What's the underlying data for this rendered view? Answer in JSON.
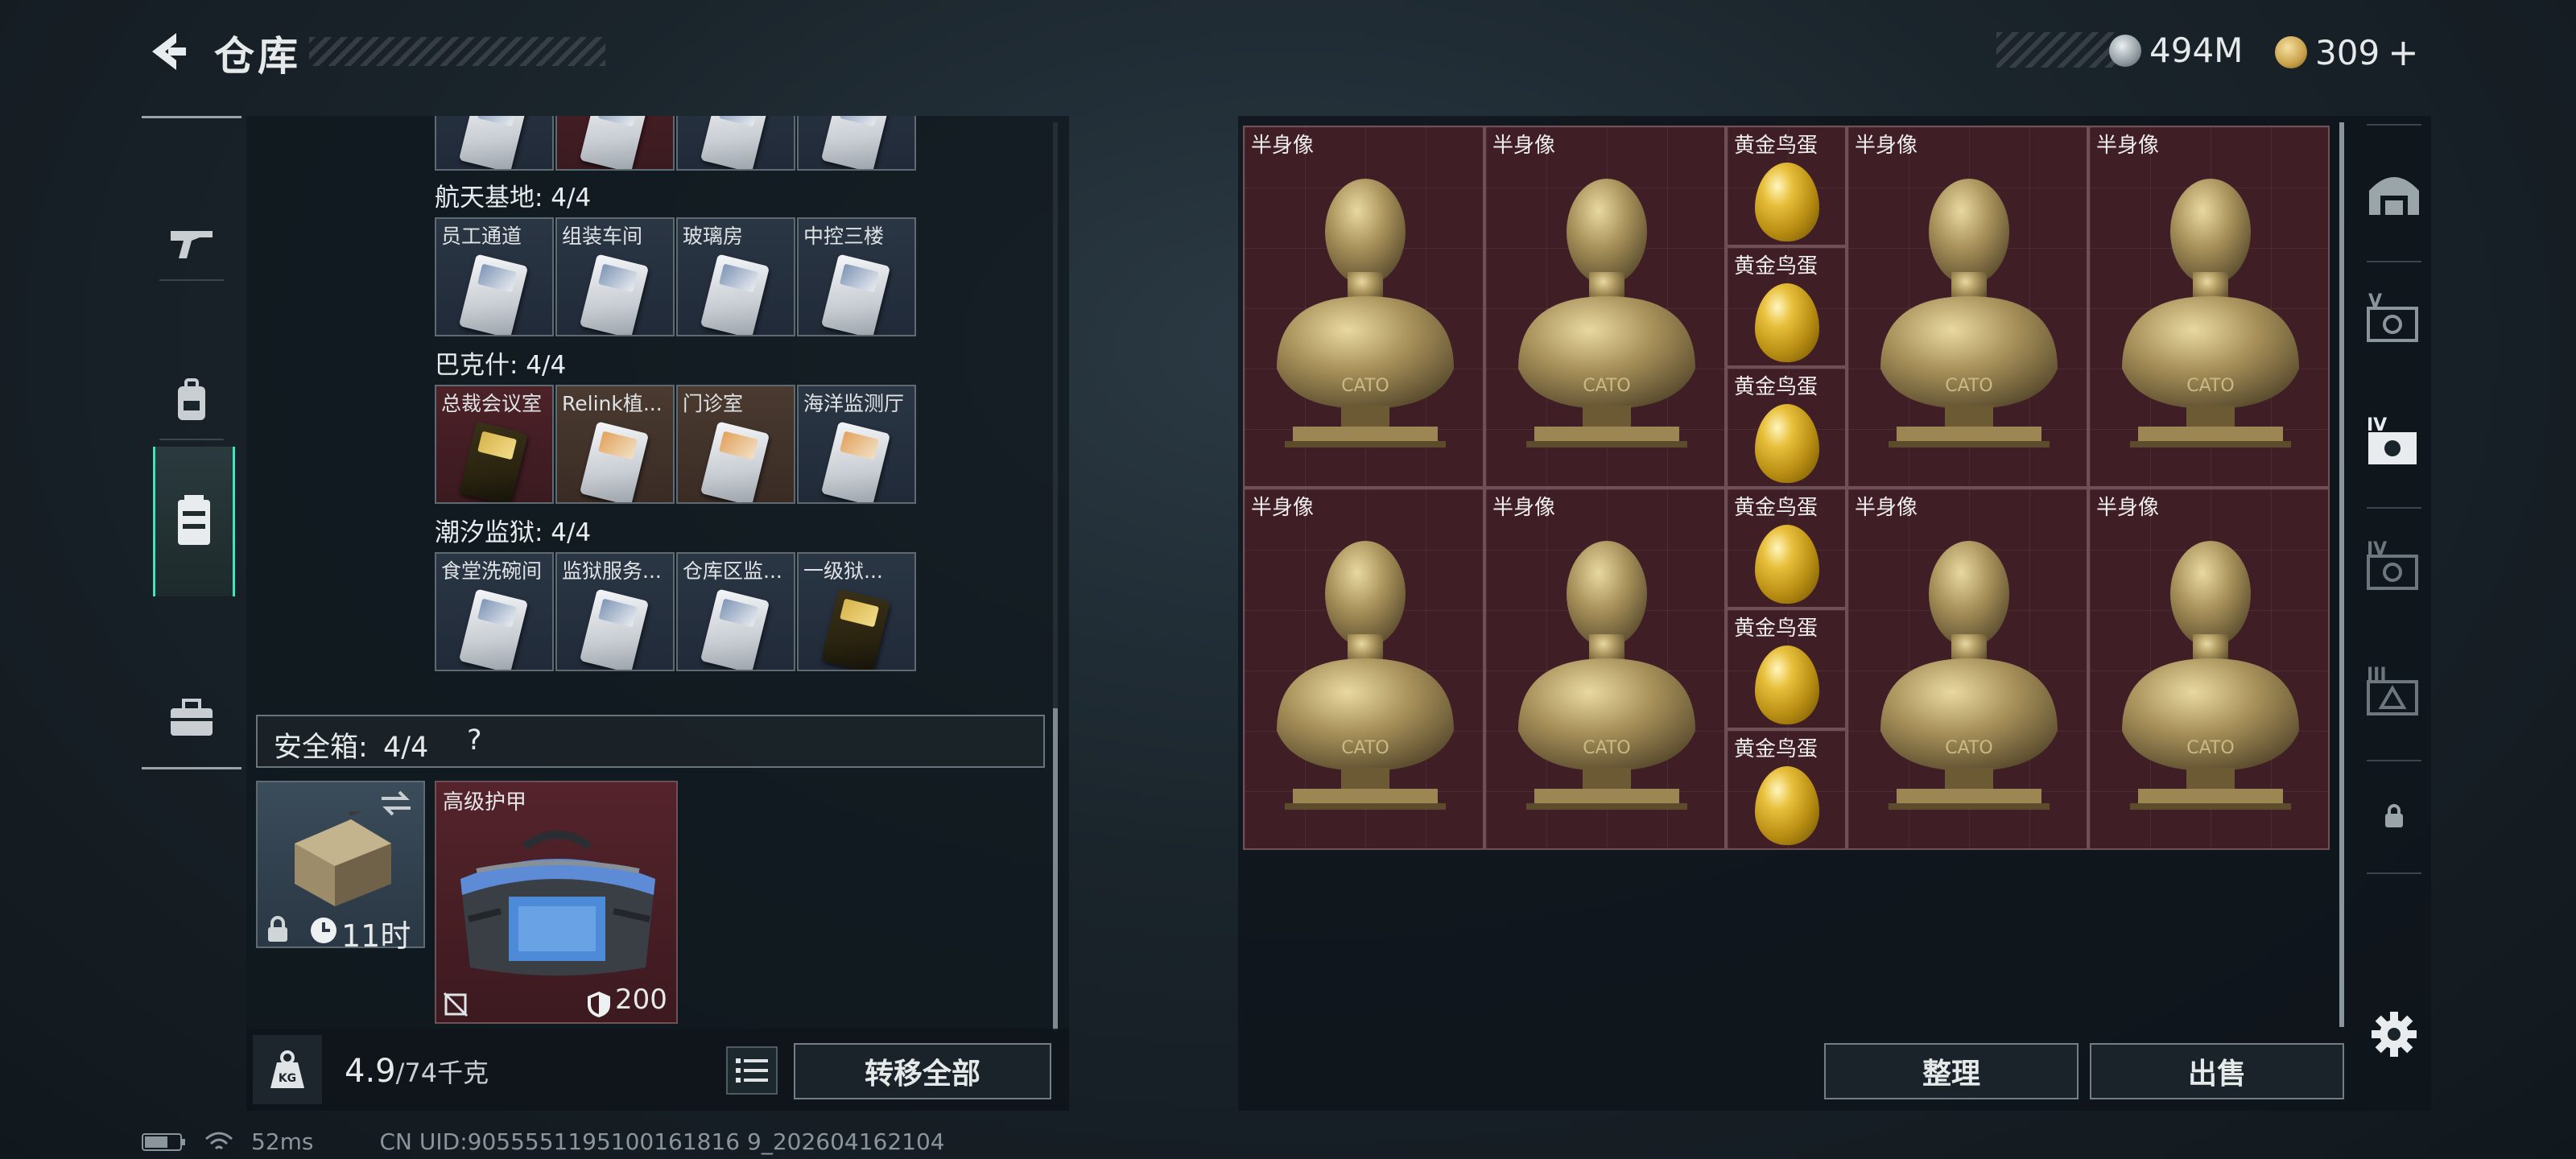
{
  "header": {
    "title": "仓库",
    "currencies": [
      {
        "name": "silver-coin",
        "value": "494M",
        "color": "#b9c3c8"
      },
      {
        "name": "gold-coin",
        "value": "309",
        "color": "#c9a04a"
      }
    ],
    "add_symbol": "+"
  },
  "left_nav": {
    "icons": [
      "weapon-icon",
      "backpack-icon",
      "armor-vest-icon",
      "toolbox-icon"
    ],
    "active_index": 2
  },
  "inventory": {
    "categories": [
      {
        "label": "航天基地: 4/4",
        "slots": [
          "员工通道",
          "组装车间",
          "玻璃房",
          "中控三楼"
        ]
      },
      {
        "label": "巴克什: 4/4",
        "slots": [
          "总裁会议室",
          "Relink植...",
          "门诊室",
          "海洋监测厅"
        ]
      },
      {
        "label": "潮汐监狱: 4/4",
        "slots": [
          "食堂洗碗间",
          "监狱服务...",
          "仓库区监...",
          "一级狱..."
        ]
      }
    ],
    "safe_box": {
      "label": "安全箱:",
      "count": "4/4",
      "help": "?",
      "timer": "11时"
    },
    "armor_item": {
      "label": "高级护甲",
      "durability": "200"
    },
    "weight": {
      "current": "4.9",
      "max": "/74千克",
      "unit_icon": "KG"
    },
    "transfer_all": "转移全部"
  },
  "stash": {
    "items": [
      {
        "label": "半身像",
        "type": "bust"
      },
      {
        "label": "半身像",
        "type": "bust"
      },
      {
        "label": "黄金鸟蛋",
        "type": "egg"
      },
      {
        "label": "黄金鸟蛋",
        "type": "egg"
      },
      {
        "label": "黄金鸟蛋",
        "type": "egg"
      },
      {
        "label": "半身像",
        "type": "bust"
      },
      {
        "label": "半身像",
        "type": "bust"
      },
      {
        "label": "半身像",
        "type": "bust"
      },
      {
        "label": "半身像",
        "type": "bust"
      },
      {
        "label": "黄金鸟蛋",
        "type": "egg"
      },
      {
        "label": "黄金鸟蛋",
        "type": "egg"
      },
      {
        "label": "黄金鸟蛋",
        "type": "egg"
      },
      {
        "label": "半身像",
        "type": "bust"
      },
      {
        "label": "半身像",
        "type": "bust"
      }
    ],
    "bust_inscription": "CATO",
    "organize": "整理",
    "sell": "出售"
  },
  "right_nav": {
    "icons": [
      "home-base-icon",
      "tier-v-safe-icon",
      "tier-iv-safe-icon-active",
      "tier-iv-safe-icon",
      "tier-iii-safe-icon",
      "lock-icon"
    ],
    "labels": [
      "V",
      "IV",
      "IV",
      "III"
    ]
  },
  "status": {
    "ping": "52ms",
    "uid": "CN UID:9055551195100161816 9_202604162104"
  }
}
